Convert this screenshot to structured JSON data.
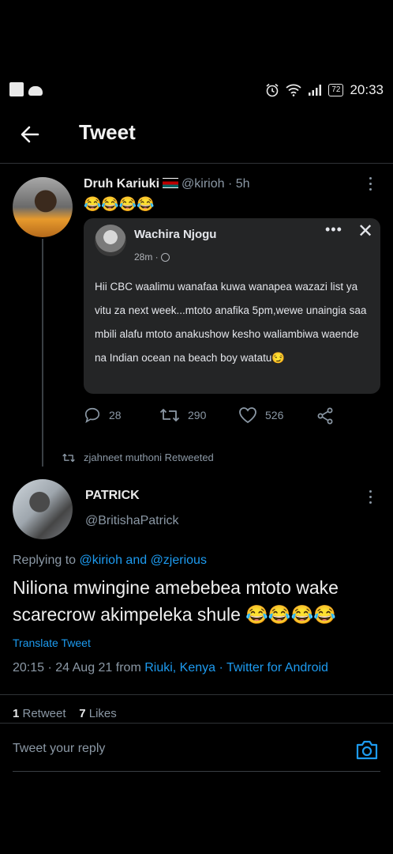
{
  "status_bar": {
    "time": "20:33",
    "battery": "72",
    "icons": [
      "notification-square-icon",
      "cloud-icon",
      "alarm-icon",
      "wifi-icon",
      "signal-icon",
      "battery-icon"
    ]
  },
  "header": {
    "title": "Tweet",
    "back_icon": "arrow-left-icon"
  },
  "quoted_thread_tweet": {
    "name": "Druh Kariuki",
    "handle_time": "@kirioh · 5h",
    "emoji": "😂😂😂😂",
    "embedded_post": {
      "author": "Wachira Njogu",
      "time": "28m ·",
      "text": "Hii CBC waalimu wanafaa kuwa wanapea wazazi list ya vitu za next week...mtoto anafika 5pm,wewe unaingia saa mbili alafu mtoto anakushow kesho waliambiwa waende na Indian ocean na beach boy watatu😏"
    },
    "actions": {
      "replies": "28",
      "retweets": "290",
      "likes": "526"
    }
  },
  "retweeted_by": "zjahneet muthoni Retweeted",
  "main_tweet": {
    "name": "PATRICK",
    "handle": "@BritishaPatrick",
    "replying_prefix": "Replying to ",
    "replying_users": "@kirioh and @zjerious",
    "text": "Niliona mwingine amebebea mtoto wake scarecrow akimpeleka shule 😂😂😂😂",
    "translate": "Translate Tweet",
    "timestamp_prefix": "20:15 · 24 Aug 21 from ",
    "location": "Riuki, Kenya",
    "separator": " · ",
    "client": "Twitter for Android",
    "retweet_count": "1",
    "retweet_label": " Retweet",
    "likes_count": "7",
    "likes_label": " Likes"
  },
  "reply_bar": {
    "placeholder": "Tweet your reply"
  },
  "colors": {
    "background": "#000000",
    "accent": "#1d9bf0",
    "secondary_text": "#8b98a5",
    "card_background": "#242526"
  }
}
